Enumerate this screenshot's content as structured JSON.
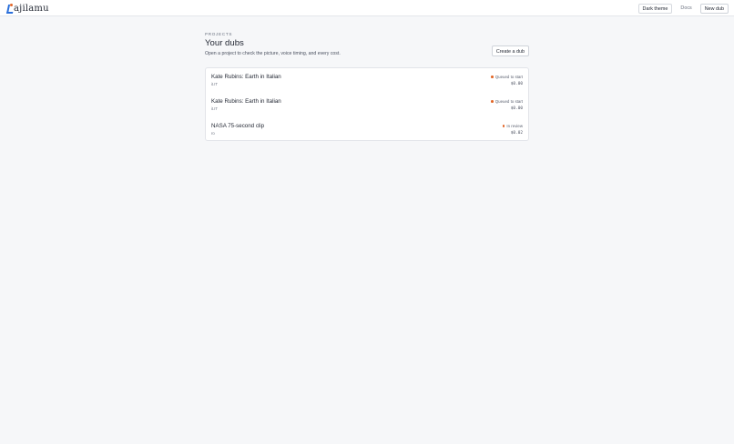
{
  "app": {
    "logo_text": "ajilamu"
  },
  "topbar": {
    "theme_label": "Dark theme",
    "docs_label": "Docs",
    "new_dub_label": "New dub"
  },
  "header": {
    "eyebrow": "PROJECTS",
    "title": "Your dubs",
    "subtitle": "Open a project to check the picture, voice timing, and every cost.",
    "create_label": "Create a dub"
  },
  "projects": [
    {
      "name": "Kate Rubins: Earth in Italian",
      "lang": "it.IT",
      "status": "Queued to start",
      "status_color": "#e2682a",
      "cost": "$0.00"
    },
    {
      "name": "Kate Rubins: Earth in Italian",
      "lang": "it.IT",
      "status": "Queued to start",
      "status_color": "#e2682a",
      "cost": "$0.00"
    },
    {
      "name": "NASA 75-second clip",
      "lang": "ro",
      "status": "In review",
      "status_color": "#e2682a",
      "cost": "$0.02"
    }
  ]
}
